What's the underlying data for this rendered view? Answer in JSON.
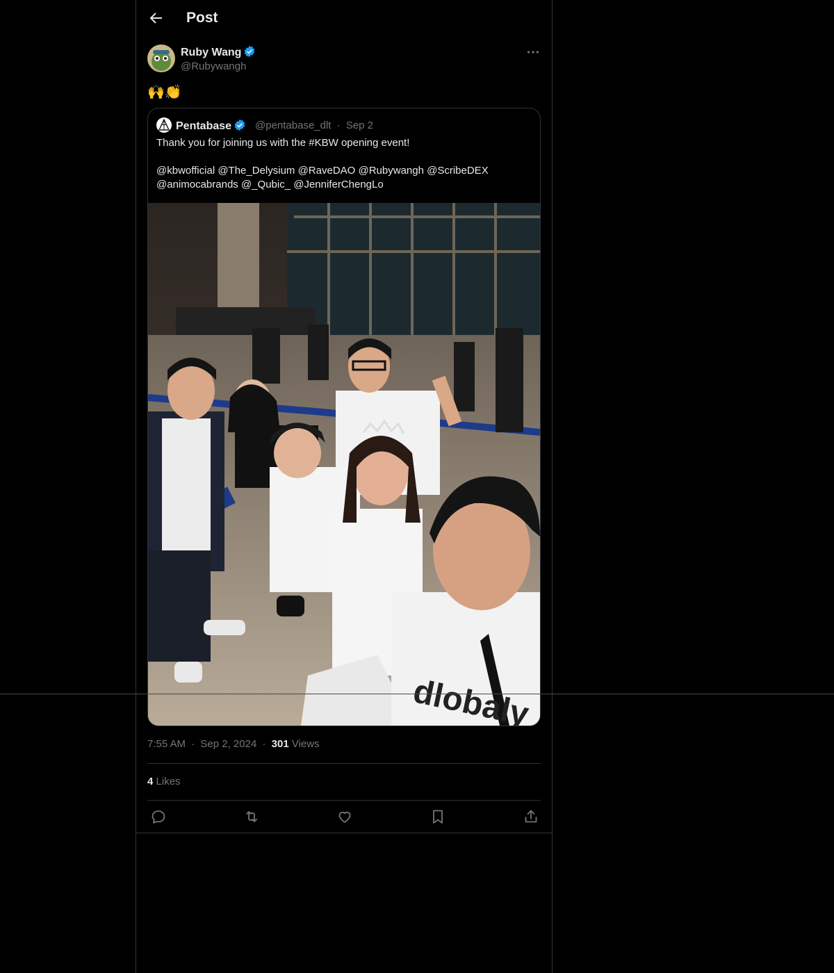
{
  "header": {
    "title": "Post",
    "back_icon": "arrow-left-icon"
  },
  "author": {
    "name": "Ruby Wang",
    "handle": "@Rubywangh",
    "verified": true,
    "verified_color": "#1d9bf0"
  },
  "post": {
    "text": "🙌👏"
  },
  "quote": {
    "name": "Pentabase",
    "handle": "@pentabase_dlt",
    "separator": "·",
    "date": "Sep 2",
    "text_line1": "Thank you for joining us with the #KBW opening event!",
    "text_line2": "@kbwofficial @The_Delysium @RaveDAO @Rubywangh @ScribeDEX",
    "text_line3": "@animocabrands @_Qubic_ @JenniferChengLo",
    "image_alt": "group-selfie-photo"
  },
  "meta": {
    "time": "7:55 AM",
    "sep1": "·",
    "date": "Sep 2, 2024",
    "sep2": "·",
    "views_count": "301",
    "views_label": "Views"
  },
  "engagement": {
    "likes_count": "4",
    "likes_label": "Likes"
  },
  "actions": [
    "reply-icon",
    "repost-icon",
    "like-icon",
    "bookmark-icon",
    "share-icon"
  ],
  "colors": {
    "background": "#000000",
    "border": "#2f3336",
    "text": "#e7e9ea",
    "muted": "#71767b",
    "accent": "#1d9bf0"
  }
}
